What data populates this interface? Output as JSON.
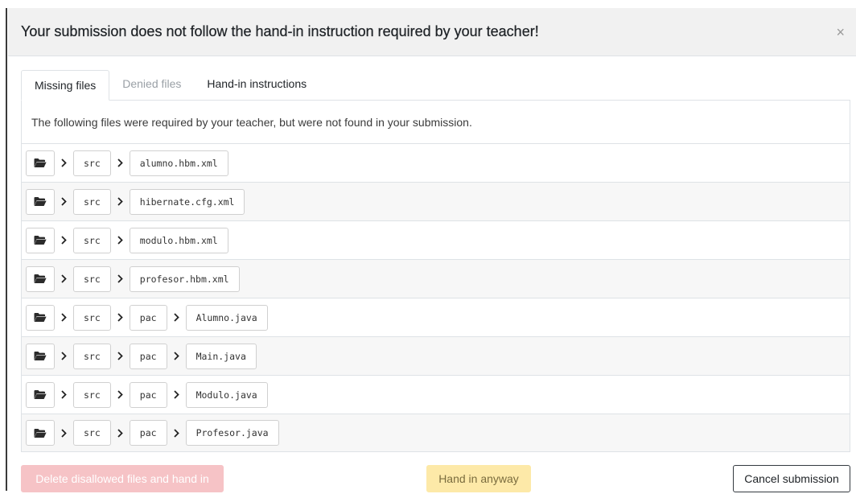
{
  "dialog": {
    "title": "Your submission does not follow the hand-in instruction required by your teacher!",
    "close_label": "×"
  },
  "tabs": [
    {
      "label": "Missing files",
      "active": true,
      "disabled": false
    },
    {
      "label": "Denied files",
      "active": false,
      "disabled": true
    },
    {
      "label": "Hand-in instructions",
      "active": false,
      "disabled": false
    }
  ],
  "missing_files": {
    "description": "The following files were required by your teacher, but were not found in your submission.",
    "files": [
      {
        "path": [
          "src",
          "alumno.hbm.xml"
        ]
      },
      {
        "path": [
          "src",
          "hibernate.cfg.xml"
        ]
      },
      {
        "path": [
          "src",
          "modulo.hbm.xml"
        ]
      },
      {
        "path": [
          "src",
          "profesor.hbm.xml"
        ]
      },
      {
        "path": [
          "src",
          "pac",
          "Alumno.java"
        ]
      },
      {
        "path": [
          "src",
          "pac",
          "Main.java"
        ]
      },
      {
        "path": [
          "src",
          "pac",
          "Modulo.java"
        ]
      },
      {
        "path": [
          "src",
          "pac",
          "Profesor.java"
        ]
      }
    ]
  },
  "footer": {
    "delete_label": "Delete disallowed files and hand in",
    "handin_label": "Hand in anyway",
    "cancel_label": "Cancel submission"
  },
  "icons": {
    "folder": "folder-open-icon",
    "separator": "chevron-right-icon",
    "close": "close-icon"
  },
  "colors": {
    "danger_disabled": "#f6c3c6",
    "warning_disabled": "#fde9a8",
    "header_bg": "#f1f1f1"
  }
}
